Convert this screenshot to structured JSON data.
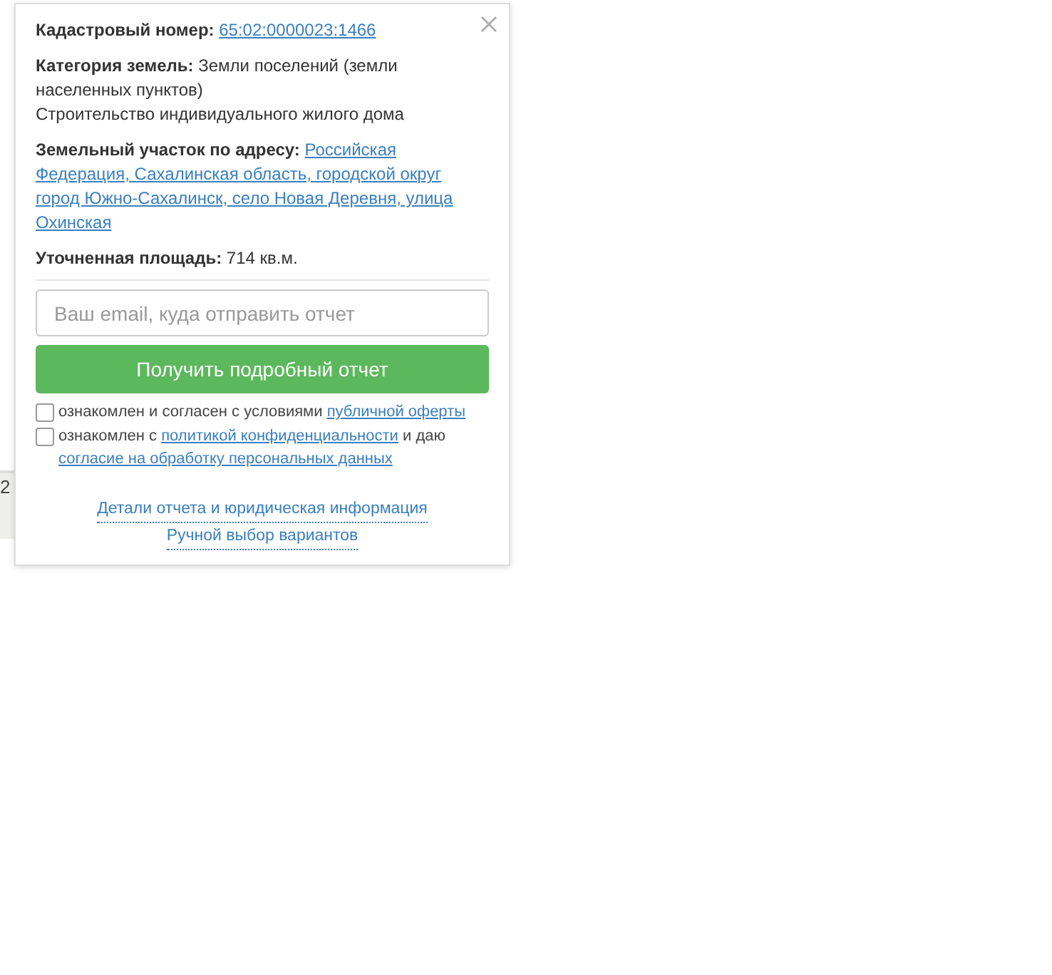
{
  "map": {
    "label": "2"
  },
  "popup": {
    "cadastral": {
      "label": "Кадастровый номер:",
      "value": "65:02:0000023:1466"
    },
    "category": {
      "label": "Категория земель:",
      "value": "Земли поселений (земли населенных пунктов)",
      "usage": "Строительство индивидуального жилого дома"
    },
    "address": {
      "label": "Земельный участок по адресу:",
      "value_lines": [
        "Российская",
        "Федерация, Сахалинская область, городской округ",
        "город Южно-Сахалинск, село Новая Деревня, улица",
        "Охинская"
      ]
    },
    "area": {
      "label": "Уточненная площадь:",
      "value": "714 кв.м."
    },
    "email": {
      "placeholder": "Ваш email, куда отправить отчет"
    },
    "submit": "Получить подробный отчет",
    "consents": [
      {
        "checked": false,
        "parts": [
          {
            "kind": "text",
            "text": "ознакомлен и согласен с условиями"
          },
          {
            "kind": "link",
            "text": "публичной оферты"
          }
        ]
      },
      {
        "checked": false,
        "parts": [
          {
            "kind": "text",
            "text": "ознакомлен с"
          },
          {
            "kind": "link",
            "text": "политикой конфиденциальности"
          },
          {
            "kind": "text",
            "text": "и даю"
          },
          {
            "kind": "link",
            "text": "согласие на обработку персональных данных"
          }
        ]
      }
    ],
    "footer_links": [
      "Детали отчета и юридическая информация",
      "Ручной выбор вариантов"
    ]
  }
}
